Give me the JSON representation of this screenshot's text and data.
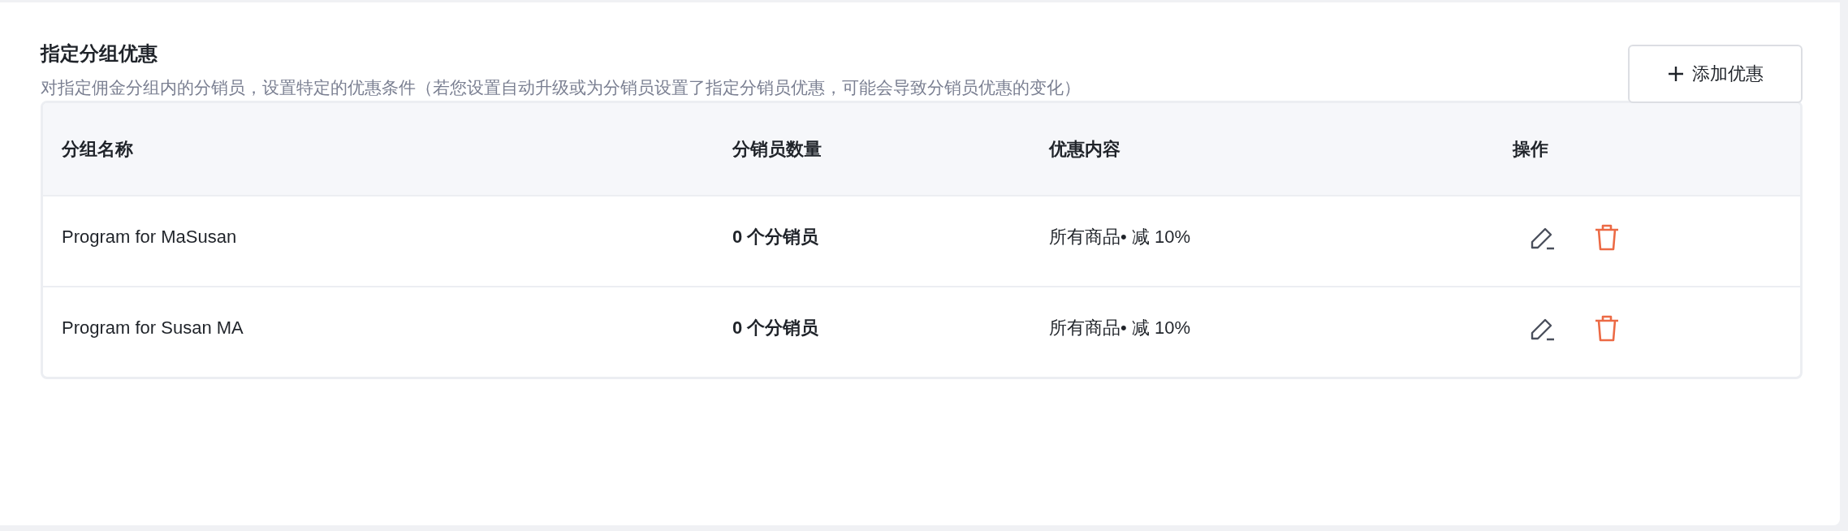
{
  "section": {
    "title": "指定分组优惠",
    "description": "对指定佣金分组内的分销员，设置特定的优惠条件（若您设置自动升级或为分销员设置了指定分销员优惠，可能会导致分销员优惠的变化）",
    "add_button": "添加优惠"
  },
  "table": {
    "columns": [
      "分组名称",
      "分销员数量",
      "优惠内容",
      "操作"
    ],
    "rows": [
      {
        "name": "Program for MaSusan",
        "count": "0 个分销员",
        "discount": "所有商品• 减 10%"
      },
      {
        "name": "Program for Susan MA",
        "count": "0 个分销员",
        "discount": "所有商品• 减 10%"
      }
    ]
  }
}
